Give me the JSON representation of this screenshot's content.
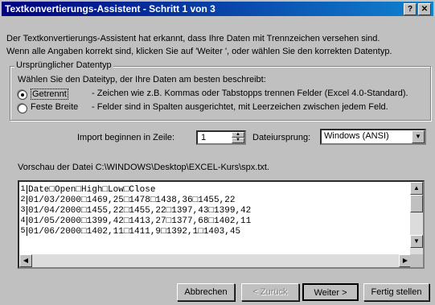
{
  "window": {
    "title": "Textkonvertierungs-Assistent - Schritt 1 von 3",
    "help_label": "?",
    "close_label": "✕"
  },
  "intro": {
    "line1": "Der Textkonvertierungs-Assistent hat erkannt, dass Ihre Daten mit Trennzeichen versehen sind.",
    "line2": "Wenn alle Angaben korrekt sind, klicken Sie auf 'Weiter ', oder wählen Sie den korrekten Datentyp."
  },
  "group": {
    "label": "Ursprünglicher Datentyp",
    "prompt": "Wählen Sie den Dateityp, der Ihre Daten am besten beschreibt:",
    "options": [
      {
        "label": "Getrennt",
        "description": "- Zeichen wie z.B. Kommas oder Tabstopps trennen Felder (Excel 4.0-Standard).",
        "selected": true
      },
      {
        "label": "Feste Breite",
        "description": "- Felder sind in Spalten ausgerichtet, mit Leerzeichen zwischen jedem Feld.",
        "selected": false
      }
    ]
  },
  "import": {
    "start_row_label": "Import beginnen in Zeile:",
    "start_row_value": "1",
    "origin_label": "Dateiursprung:",
    "origin_value": "Windows (ANSI)"
  },
  "preview": {
    "label": "Vorschau der Datei C:\\WINDOWS\\Desktop\\EXCEL-Kurs\\spx.txt.",
    "lines": [
      {
        "num": "1",
        "text": "Date□Open□High□Low□Close"
      },
      {
        "num": "2",
        "text": "01/03/2000□1469,25□1478□1438,36□1455,22"
      },
      {
        "num": "3",
        "text": "01/04/2000□1455,22□1455,22□1397,43□1399,42"
      },
      {
        "num": "4",
        "text": "01/05/2000□1399,42□1413,27□1377,68□1402,11"
      },
      {
        "num": "5",
        "text": "01/06/2000□1402,11□1411,9□1392,1□1403,45"
      }
    ]
  },
  "buttons": {
    "cancel": "Abbrechen",
    "back": "< Zurück",
    "next": "Weiter >",
    "finish": "Fertig stellen"
  },
  "colors": {
    "titlebar_start": "#000080",
    "titlebar_end": "#1084d0",
    "face": "#c0c0c0"
  }
}
